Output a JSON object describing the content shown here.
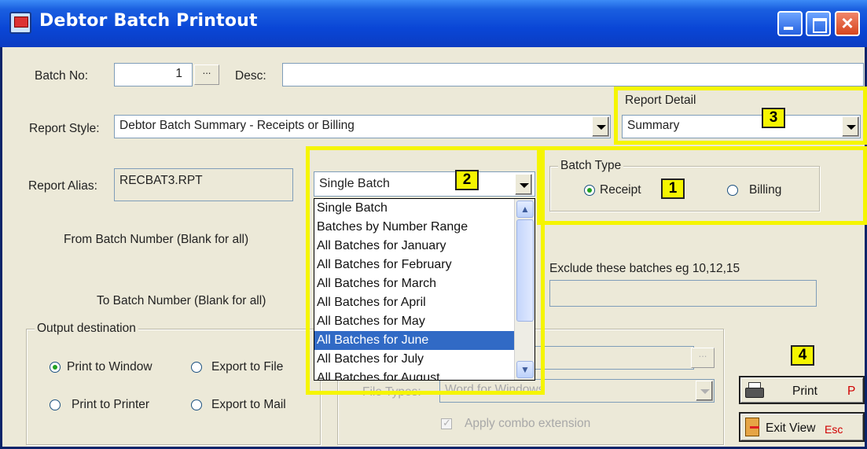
{
  "window": {
    "title": "Debtor Batch Printout"
  },
  "batch": {
    "label": "Batch No:",
    "value": "1",
    "browse_label": "..."
  },
  "desc": {
    "label": "Desc:",
    "value": ""
  },
  "report_style": {
    "label": "Report Style:",
    "value": "Debtor Batch Summary - Receipts or Billing"
  },
  "report_detail": {
    "label": "Report Detail",
    "value": "Summary"
  },
  "report_alias": {
    "label": "Report Alias:",
    "value": "RECBAT3.RPT"
  },
  "batch_range": {
    "value": "Single Batch"
  },
  "batch_range_options": [
    "Single Batch",
    "Batches by Number Range",
    "All Batches for January",
    "All Batches for February",
    "All Batches for March",
    "All Batches for April",
    "All Batches for May",
    "All Batches for June",
    "All Batches for July",
    "All Batches for August"
  ],
  "batch_range_selected": "All Batches for June",
  "batch_type": {
    "label": "Batch Type",
    "receipt": "Receipt",
    "billing": "Billing",
    "selected": "Receipt"
  },
  "from_batch": {
    "label": "From Batch Number  (Blank for all)"
  },
  "to_batch": {
    "label": "To Batch Number (Blank for all)"
  },
  "exclude": {
    "label": "Exclude these batches  eg 10,12,15",
    "value": ""
  },
  "output": {
    "label": "Output destination",
    "print_window": "Print to Window",
    "export_file": "Export to File",
    "print_printer": "Print to Printer",
    "export_mail": "Export to Mail",
    "selected": "Print to Window"
  },
  "export_opts": {
    "file_types_label": "File Types:",
    "file_types_value": "Word for Windows",
    "browse_label": "...",
    "apply_combo": "Apply combo extension"
  },
  "buttons": {
    "print": "Print",
    "print_key": "P",
    "exit": "Exit View",
    "exit_key": "Esc"
  },
  "badges": [
    "1",
    "2",
    "3",
    "4"
  ],
  "colors": {
    "highlight": "#f5f500",
    "titlebar": "#0a46d6",
    "selection": "#316ac5",
    "hotkey": "#d00000"
  }
}
